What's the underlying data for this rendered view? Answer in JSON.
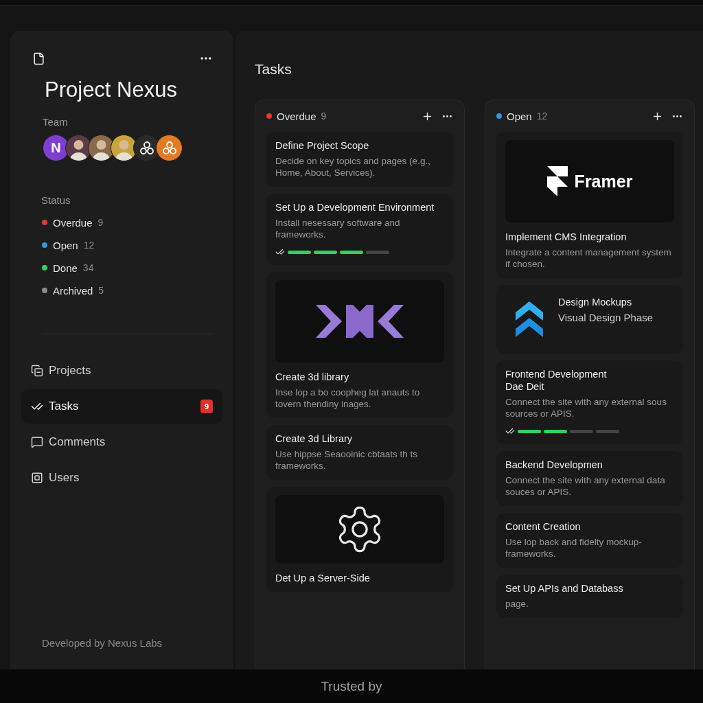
{
  "sidebar": {
    "title": "Project Nexus",
    "team_label": "Team",
    "team": [
      {
        "kind": "initial",
        "text": "N",
        "color": "#7e3fd0"
      },
      {
        "kind": "person",
        "color": "#5a3b4a"
      },
      {
        "kind": "person",
        "color": "#8a6a4a"
      },
      {
        "kind": "person",
        "color": "#c9a43a"
      },
      {
        "kind": "logo",
        "color": "#2a2a2a"
      },
      {
        "kind": "logo",
        "color": "#e57a25"
      }
    ],
    "status_label": "Status",
    "statuses": [
      {
        "label": "Overdue",
        "count": "9",
        "color": "#e5392f"
      },
      {
        "label": "Open",
        "count": "12",
        "color": "#2d9ae0"
      },
      {
        "label": "Done",
        "count": "34",
        "color": "#2fd15c"
      },
      {
        "label": "Archived",
        "count": "5",
        "color": "#8a8a8a"
      }
    ],
    "nav": [
      {
        "label": "Projects",
        "selected": false
      },
      {
        "label": "Tasks",
        "selected": true,
        "badge": "9"
      },
      {
        "label": "Comments",
        "selected": false
      },
      {
        "label": "Users",
        "selected": false
      }
    ],
    "footer": "Developed by Nexus Labs"
  },
  "main": {
    "title": "Tasks",
    "columns": [
      {
        "label": "Overdue",
        "count": "9",
        "color": "#e5392f",
        "cards": [
          {
            "kind": "text",
            "title": "Define Project Scope",
            "description": "Decide on key topics and pages (e.g., Home, About, Services)."
          },
          {
            "kind": "text",
            "title": "Set Up a Development Environment",
            "description": "Install nesessary software and frameworks.",
            "level": 0.75
          },
          {
            "kind": "arrows",
            "title": "Create 3d library",
            "description": "Inse lop a bo coopheg lat anauts to tovern thendiny inages."
          },
          {
            "kind": "text",
            "title": "Create 3d Library",
            "description": "Use hippse Seaooinic cbtaats th  ts frameworks."
          },
          {
            "kind": "gear",
            "title": "Det Up a Server-Side"
          }
        ]
      },
      {
        "label": "Open",
        "count": "12",
        "color": "#2d9ae0",
        "cards": [
          {
            "kind": "framer",
            "media_text": "Framer",
            "title": "Implement CMS Integration",
            "description": "Integrate a content management system if chosen."
          },
          {
            "kind": "side",
            "title": "Design Mockups",
            "description": "Visual Design Phase"
          },
          {
            "kind": "text",
            "title": "Frontend Development",
            "subtitle": "Dae Deit",
            "description": "Connect the site with any external sous sources or APIS.",
            "level": 0.5
          },
          {
            "kind": "text",
            "title": "Backend Developmen",
            "description": "Connect the site with any external data souces or APIS."
          },
          {
            "kind": "text",
            "title": "Content Creation",
            "description": "Use lop back and fidelty mockup-frameworks."
          },
          {
            "kind": "text",
            "title": "Set Up APIs and Databass",
            "description": "page."
          }
        ]
      }
    ]
  },
  "footer_overlay": {
    "text": "Trusted by"
  }
}
